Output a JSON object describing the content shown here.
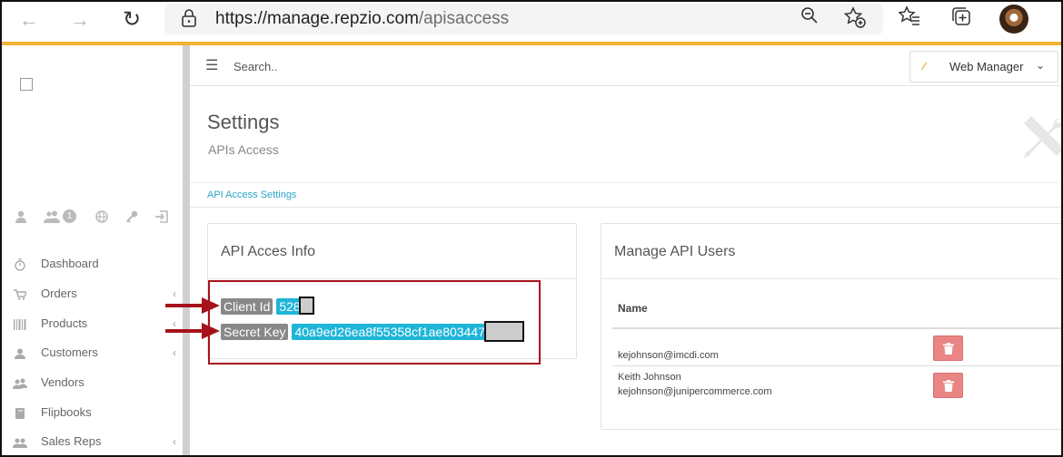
{
  "browser": {
    "url_host": "https://manage.repzio.com",
    "url_path": "/apisaccess"
  },
  "sidebar": {
    "quick_badge": "1",
    "items": [
      {
        "label": "Dashboard",
        "icon": "stopwatch-icon",
        "has_arrow": false
      },
      {
        "label": "Orders",
        "icon": "cart-icon",
        "has_arrow": true
      },
      {
        "label": "Products",
        "icon": "barcode-icon",
        "has_arrow": true
      },
      {
        "label": "Customers",
        "icon": "user-icon",
        "has_arrow": true
      },
      {
        "label": "Vendors",
        "icon": "vendors-icon",
        "has_arrow": false
      },
      {
        "label": "Flipbooks",
        "icon": "book-icon",
        "has_arrow": false
      },
      {
        "label": "Sales Reps",
        "icon": "sales-reps-icon",
        "has_arrow": true
      }
    ]
  },
  "header": {
    "search_placeholder": "Search..",
    "web_manager_label": "Web Manager"
  },
  "page": {
    "title": "Settings",
    "subtitle": "APIs Access",
    "breadcrumb": "API Access Settings"
  },
  "api_info": {
    "title": "API Acces Info",
    "client_id_label": "Client Id",
    "client_id_value": "528",
    "secret_key_label": "Secret Key",
    "secret_key_value": "40a9ed26ea8f55358cf1ae803447"
  },
  "api_users": {
    "title": "Manage API Users",
    "column_name": "Name",
    "rows": [
      {
        "name": "",
        "email": "kejohnson@imcdi.com"
      },
      {
        "name": "Keith Johnson",
        "email": "kejohnson@junipercommerce.com"
      }
    ]
  },
  "colors": {
    "accent": "#f2b233",
    "info_label": "#1fb5d9",
    "danger": "#e98584",
    "annotation": "#a6121b"
  }
}
